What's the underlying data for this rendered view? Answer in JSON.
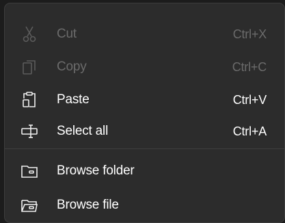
{
  "menu": {
    "items": [
      {
        "label": "Cut",
        "shortcut": "Ctrl+X",
        "icon": "scissors-icon",
        "enabled": false
      },
      {
        "label": "Copy",
        "shortcut": "Ctrl+C",
        "icon": "copy-icon",
        "enabled": false
      },
      {
        "label": "Paste",
        "shortcut": "Ctrl+V",
        "icon": "clipboard-icon",
        "enabled": true
      },
      {
        "label": "Select all",
        "shortcut": "Ctrl+A",
        "icon": "select-all-icon",
        "enabled": true
      },
      {
        "label": "Browse folder",
        "icon": "folder-icon",
        "enabled": true
      },
      {
        "label": "Browse file",
        "icon": "folder-open-icon",
        "enabled": true
      }
    ]
  },
  "colors": {
    "menu_background": "#2c2c2c",
    "text": "#ffffff",
    "disabled_text": "#6b6b6b",
    "separator": "#3f3f3f"
  }
}
